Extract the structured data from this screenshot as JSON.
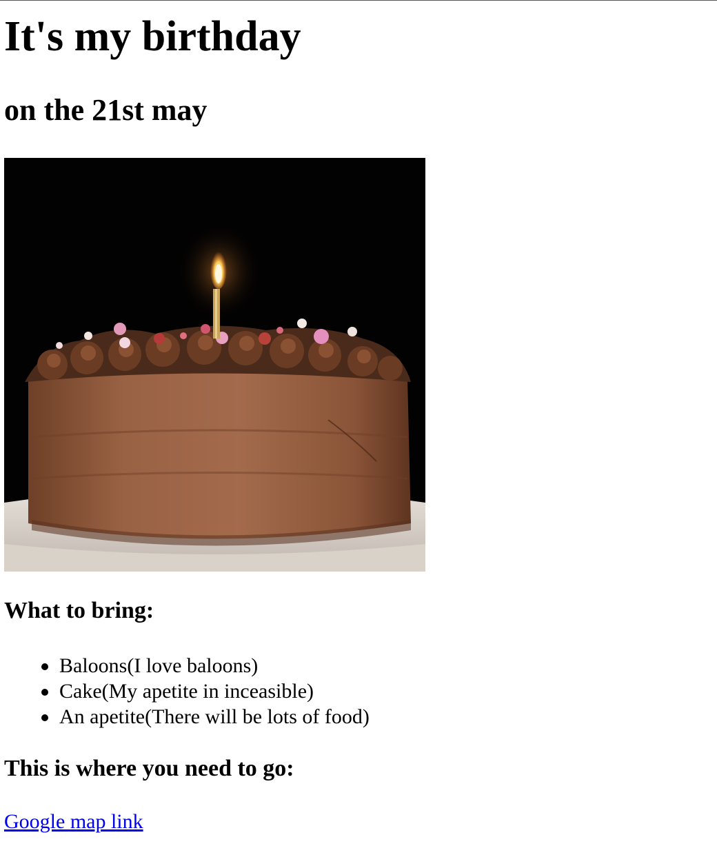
{
  "page": {
    "title": "It's my birthday",
    "subtitle": "on the 21st may"
  },
  "image": {
    "icon": "birthday-cake-photo"
  },
  "bring": {
    "heading": "What to bring:",
    "items": [
      "Baloons(I love baloons)",
      "Cake(My apetite in inceasible)",
      "An apetite(There will be lots of food)"
    ]
  },
  "location": {
    "heading": "This is where you need to go:",
    "link_text": "Google map link"
  },
  "colors": {
    "link": "#0000ee",
    "text": "#000000",
    "background": "#ffffff"
  }
}
